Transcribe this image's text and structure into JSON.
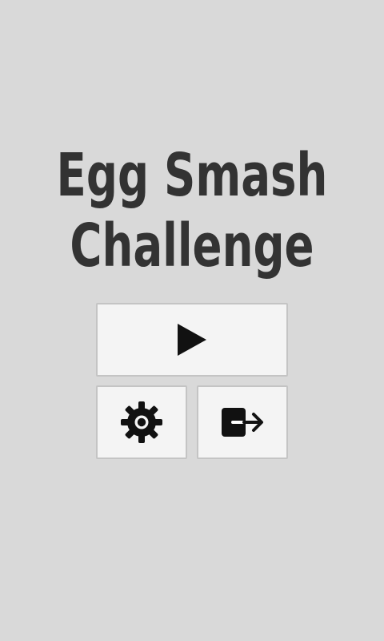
{
  "app": {
    "title_line1": "Egg Smash",
    "title_line2": "Challenge"
  },
  "menu": {
    "play_icon": "play-icon",
    "settings_icon": "gear-icon",
    "exit_icon": "exit-icon"
  },
  "colors": {
    "background": "#d9d9d9",
    "title": "#333333",
    "button_bg": "#f4f4f4",
    "button_border": "#c4c4c4",
    "icon": "#111111"
  }
}
